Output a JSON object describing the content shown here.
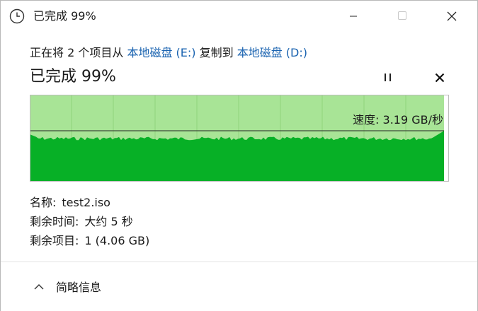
{
  "window": {
    "title": "已完成 99%"
  },
  "copy": {
    "action_prefix": "正在将 2 个项目从 ",
    "source": "本地磁盘 (E:)",
    "action_middle": " 复制到 ",
    "destination": "本地磁盘 (D:)",
    "progress_text": "已完成 99%",
    "progress_fraction": 0.99,
    "speed_label": "速度: 3.19 GB/秒"
  },
  "details": {
    "name_label": "名称:",
    "name_value": "test2.iso",
    "time_label": "剩余时间:",
    "time_value": "大约 5 秒",
    "items_label": "剩余项目:",
    "items_value": "1 (4.06 GB)"
  },
  "footer": {
    "less_details_label": "简略信息"
  },
  "colors": {
    "graph_fill": "#07b026",
    "graph_background": "#a8e496",
    "link": "#1a63b0"
  },
  "icons": {
    "title": "clock-icon",
    "minimize": "minimize-icon",
    "maximize": "maximize-icon",
    "close": "close-icon",
    "pause": "pause-icon",
    "cancel": "cancel-icon",
    "collapse": "chevron-up-icon"
  }
}
